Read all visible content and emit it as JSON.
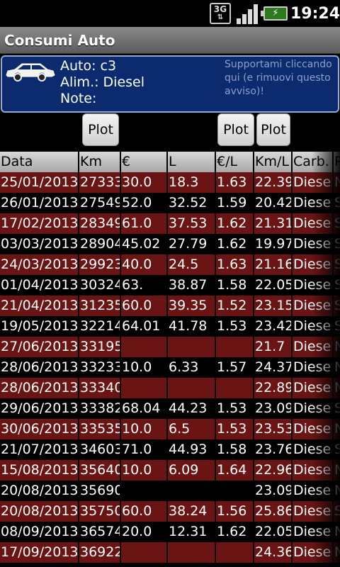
{
  "status_bar": {
    "network": "3G",
    "battery_symbol": "⚡",
    "time": "19:24"
  },
  "app": {
    "title": "Consumi Auto"
  },
  "car_info": {
    "auto": "Auto: c3",
    "alim": "Alim.: Diesel",
    "note": "Note:",
    "ad": "Supportami cliccando qui (e rimuovi questo avviso)!"
  },
  "plot_buttons": [
    "Plot",
    "Plot",
    "Plot"
  ],
  "table": {
    "headers": [
      "Data",
      "Km",
      "€",
      "L",
      "€/L",
      "Km/L",
      "Carb.",
      "P"
    ],
    "rows": [
      [
        "25/01/2013",
        "27333",
        "30.0",
        "18.3",
        "1.63",
        "22.39",
        "Diesel",
        "N"
      ],
      [
        "26/01/2013",
        "27549",
        "52.0",
        "32.52",
        "1.59",
        "20.42",
        "Diesel",
        "S"
      ],
      [
        "17/02/2013",
        "28349",
        "61.0",
        "37.53",
        "1.62",
        "21.31",
        "Diesel",
        "S"
      ],
      [
        "03/03/2013",
        "28904",
        "45.02",
        "27.79",
        "1.62",
        "19.97",
        "Diesel",
        "S"
      ],
      [
        "24/03/2013",
        "29923",
        "40.0",
        "24.5",
        "1.63",
        "21.16",
        "Diesel",
        "S"
      ],
      [
        "01/04/2013",
        "30324",
        "63.",
        "38.87",
        "1.58",
        "22.05",
        "Diesel",
        "S"
      ],
      [
        "21/04/2013",
        "31235",
        "60.0",
        "39.35",
        "1.52",
        "23.15",
        "Diesel",
        "S"
      ],
      [
        "19/05/2013",
        "32214",
        "64.01",
        "41.78",
        "1.53",
        "23.42",
        "Diesel",
        "S"
      ],
      [
        "27/06/2013",
        "33195",
        "",
        "",
        "",
        "21.7",
        "Diesel",
        "N"
      ],
      [
        "28/06/2013",
        "33233",
        "10.0",
        "6.33",
        "1.57",
        "24.37",
        "Diesel",
        "N"
      ],
      [
        "28/06/2013",
        "33340",
        "",
        "",
        "",
        "22.89",
        "Diesel",
        "N"
      ],
      [
        "29/06/2013",
        "33382",
        "68.04",
        "44.23",
        "1.53",
        "23.09",
        "Diesel",
        "S"
      ],
      [
        "30/06/2013",
        "33535",
        "10.0",
        "6.5",
        "1.53",
        "23.53",
        "Diesel",
        "N"
      ],
      [
        "21/07/2013",
        "34603",
        "71.0",
        "44.93",
        "1.58",
        "23.76",
        "Diesel",
        "S"
      ],
      [
        "15/08/2013",
        "35640",
        "10.0",
        "6.09",
        "1.64",
        "22.96",
        "Diesel",
        "N"
      ],
      [
        "20/08/2013",
        "35690",
        "",
        "",
        "",
        "23.09",
        "Diesel",
        "N"
      ],
      [
        "20/08/2013",
        "35750",
        "60.0",
        "38.24",
        "1.56",
        "25.86",
        "Diesel",
        "S"
      ],
      [
        "08/09/2013",
        "36574",
        "20.0",
        "12.31",
        "1.62",
        "22.05",
        "Diesel",
        "N"
      ],
      [
        "17/09/2013",
        "36922",
        "",
        "",
        "",
        "24.36",
        "Diesel",
        "N"
      ]
    ],
    "row_colors": [
      "red",
      "dark",
      "red",
      "dark",
      "red",
      "dark",
      "red",
      "dark",
      "red",
      "dark",
      "red",
      "dark",
      "red",
      "dark",
      "red",
      "dark",
      "red",
      "dark",
      "red"
    ]
  },
  "colors": {
    "row_red": "#6b1414",
    "row_dark": "#000000",
    "header_bg": "#c0c0c0",
    "carbox_bg": "#0c2a6e",
    "carbox_border": "#8fa9d9"
  }
}
